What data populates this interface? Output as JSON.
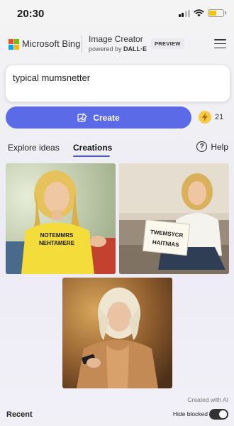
{
  "status_bar": {
    "time": "20:30",
    "battery_level": 0.5,
    "battery_color": "#f5c400"
  },
  "header": {
    "brand": "Microsoft Bing",
    "product_title": "Image Creator",
    "powered_by_prefix": "powered by",
    "powered_by_name": "DALL·E",
    "badge": "PREVIEW"
  },
  "prompt": {
    "value": "typical mumsnetter"
  },
  "create": {
    "label": "Create",
    "boosts_count": "21",
    "accent": "#5b6ae6"
  },
  "tabs": {
    "explore": "Explore ideas",
    "creations": "Creations",
    "active": "Creations",
    "help": "Help"
  },
  "images": [
    {
      "shirt_text_line1": "NOTEMMRS",
      "shirt_text_line2": "NEHTAMERE"
    },
    {
      "sign_text_line1": "TWEMSYCR",
      "sign_text_line2": "HAITNIAS"
    },
    {}
  ],
  "footer": {
    "created_with_ai": "Created with AI",
    "recent": "Recent",
    "hide_blocked": "Hide blocked"
  }
}
